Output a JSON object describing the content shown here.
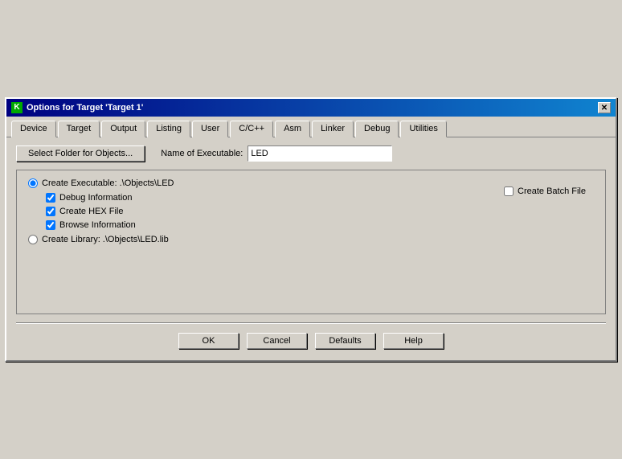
{
  "window": {
    "title": "Options for Target 'Target 1'",
    "close_button": "✕"
  },
  "tabs": {
    "items": [
      {
        "label": "Device",
        "active": false
      },
      {
        "label": "Target",
        "active": false
      },
      {
        "label": "Output",
        "active": true
      },
      {
        "label": "Listing",
        "active": false
      },
      {
        "label": "User",
        "active": false
      },
      {
        "label": "C/C++",
        "active": false
      },
      {
        "label": "Asm",
        "active": false
      },
      {
        "label": "Linker",
        "active": false
      },
      {
        "label": "Debug",
        "active": false
      },
      {
        "label": "Utilities",
        "active": false
      }
    ]
  },
  "content": {
    "select_folder_label": "Select Folder for Objects...",
    "name_exe_label": "Name of Executable:",
    "name_exe_value": "LED",
    "create_executable_label": "Create Executable:  .\\Objects\\LED",
    "debug_info_label": "Debug Information",
    "create_hex_label": "Create HEX File",
    "browse_info_label": "Browse Information",
    "create_library_label": "Create Library:  .\\Objects\\LED.lib",
    "create_batch_label": "Create Batch File",
    "debug_info_checked": true,
    "create_hex_checked": true,
    "browse_info_checked": true,
    "create_batch_checked": false,
    "create_executable_selected": true,
    "create_library_selected": false
  },
  "buttons": {
    "ok": "OK",
    "cancel": "Cancel",
    "defaults": "Defaults",
    "help": "Help"
  }
}
